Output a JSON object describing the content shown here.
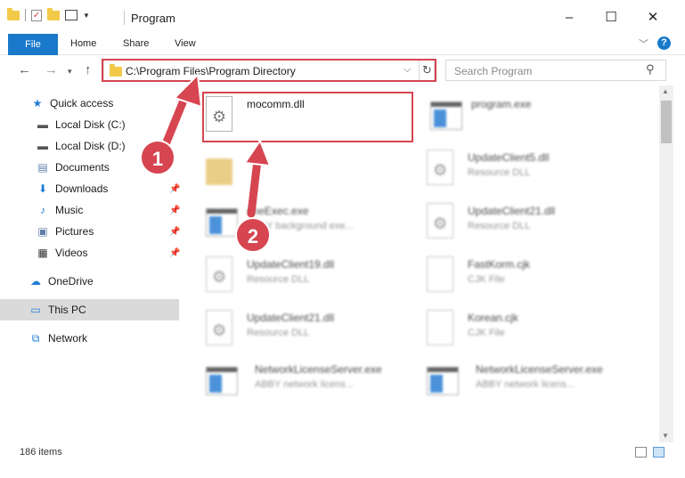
{
  "window": {
    "title": "Program",
    "controls": {
      "minimize": "–",
      "maximize": "☐",
      "close": "✕"
    }
  },
  "ribbon": {
    "tabs": [
      "File",
      "Home",
      "Share",
      "View"
    ],
    "help": "?"
  },
  "address": {
    "path": "C:\\Program Files\\Program Directory",
    "refresh": "↻"
  },
  "search": {
    "placeholder": "Search Program"
  },
  "nav": {
    "items": [
      {
        "label": "Quick access",
        "icon": "star-icon"
      },
      {
        "label": "Local Disk (C:)",
        "icon": "drive-icon"
      },
      {
        "label": "Local Disk (D:)",
        "icon": "drive-icon"
      },
      {
        "label": "Documents",
        "icon": "documents-icon"
      },
      {
        "label": "Downloads",
        "icon": "downloads-icon"
      },
      {
        "label": "Music",
        "icon": "music-icon"
      },
      {
        "label": "Pictures",
        "icon": "pictures-icon"
      },
      {
        "label": "Videos",
        "icon": "videos-icon"
      },
      {
        "label": "OneDrive",
        "icon": "onedrive-icon"
      },
      {
        "label": "This PC",
        "icon": "pc-icon"
      },
      {
        "label": "Network",
        "icon": "network-icon"
      }
    ]
  },
  "files": [
    {
      "name": "mocomm.dll",
      "type": "",
      "icon": "dll-icon"
    },
    {
      "name": "program.exe",
      "type": "",
      "icon": "exe-icon"
    },
    {
      "name": "",
      "type": "",
      "icon": "folder-icon"
    },
    {
      "name": "UpdateClient5.dll",
      "type": "Resource DLL",
      "icon": "dll-icon"
    },
    {
      "name": "eneExec.exe",
      "type": "ABBY background exe...",
      "icon": "exe-icon"
    },
    {
      "name": "UpdateClient21.dll",
      "type": "Resource DLL",
      "icon": "dll-icon"
    },
    {
      "name": "UpdateClient19.dll",
      "type": "Resource DLL",
      "icon": "dll-icon"
    },
    {
      "name": "FastKorm.cjk",
      "type": "CJK File",
      "icon": "file-icon"
    },
    {
      "name": "UpdateClient21.dll",
      "type": "Resource DLL",
      "icon": "dll-icon"
    },
    {
      "name": "Korean.cjk",
      "type": "CJK File",
      "icon": "file-icon"
    },
    {
      "name": "NetworkLicenseServer.exe",
      "type": "ABBY network licens...",
      "icon": "exe-icon"
    },
    {
      "name": "NetworkLicenseServer.exe",
      "type": "ABBY network licens...",
      "icon": "exe-icon"
    }
  ],
  "status": {
    "count": "186 items"
  },
  "annotations": {
    "step1": "1",
    "step2": "2",
    "color": "#d64550"
  }
}
